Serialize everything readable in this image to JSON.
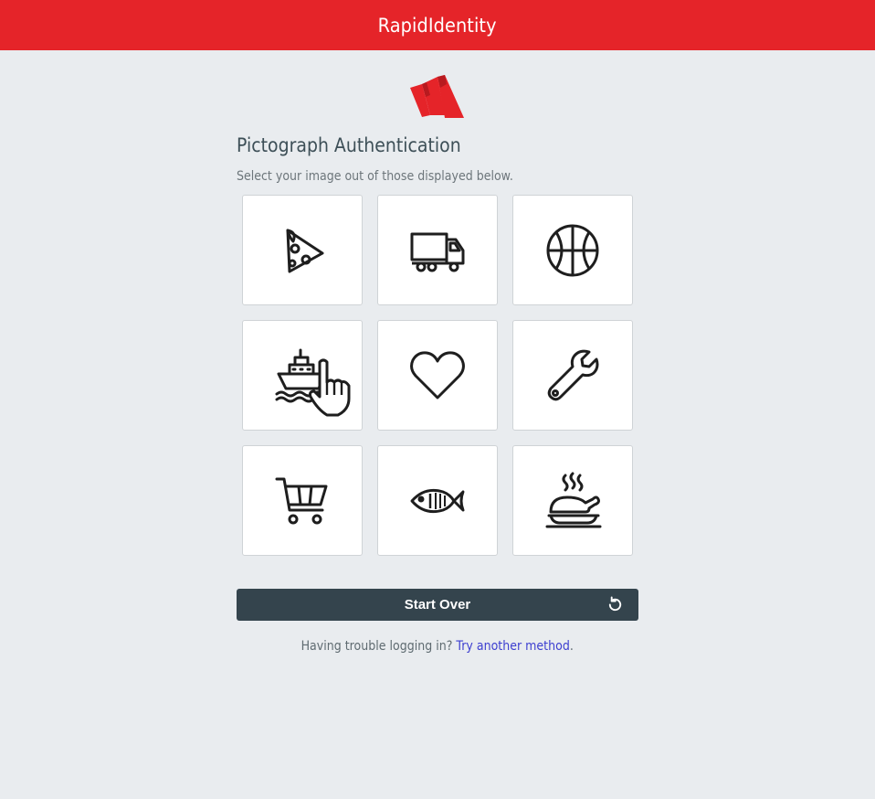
{
  "header": {
    "app_title": "RapidIdentity",
    "brand_color": "#e52429"
  },
  "logo": {
    "icon": "rapididentity-logo-icon"
  },
  "main": {
    "title": "Pictograph Authentication",
    "instructions": "Select your image out of those displayed below.",
    "pictographs": [
      {
        "icon": "pizza-icon"
      },
      {
        "icon": "truck-icon"
      },
      {
        "icon": "basketball-icon"
      },
      {
        "icon": "ship-icon"
      },
      {
        "icon": "heart-icon"
      },
      {
        "icon": "wrench-icon"
      },
      {
        "icon": "shopping-cart-icon"
      },
      {
        "icon": "fish-icon"
      },
      {
        "icon": "roast-chicken-icon"
      }
    ],
    "start_over_label": "Start Over",
    "start_over_icon": "refresh-icon",
    "button_color": "#34444d"
  },
  "footer": {
    "trouble_text": "Having trouble logging in?",
    "alt_method_link": "Try another method",
    "trailing": "."
  }
}
